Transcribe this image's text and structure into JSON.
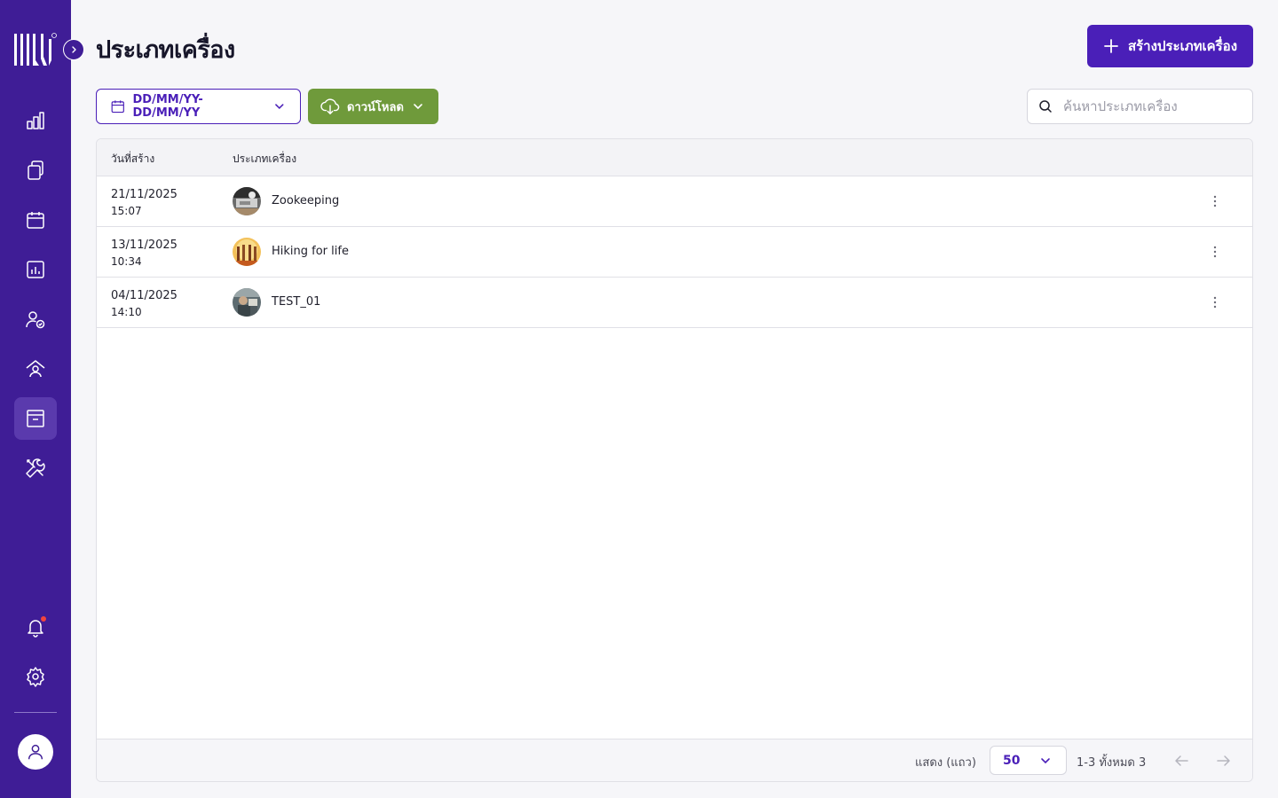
{
  "page": {
    "title": "ประเภทเครื่อง",
    "create_button": "สร้างประเภทเครื่อง"
  },
  "toolbar": {
    "date_range": "DD/MM/YY-DD/MM/YY",
    "download": "ดาวน์โหลด",
    "search_placeholder": "ค้นหาประเภทเครื่อง"
  },
  "table": {
    "columns": [
      "วันที่สร้าง",
      "ประเภทเครื่อง"
    ],
    "rows": [
      {
        "date": "21/11/2025",
        "time": "15:07",
        "name": "Zookeeping"
      },
      {
        "date": "13/11/2025",
        "time": "10:34",
        "name": "Hiking for life"
      },
      {
        "date": "04/11/2025",
        "time": "14:10",
        "name": "TEST_01"
      }
    ]
  },
  "pagination": {
    "rows_label": "แสดง (แถว)",
    "rows_per_page": "50",
    "range": "1-3 ทั้งหมด 3"
  },
  "sidebar": {
    "items": [
      {
        "icon": "bar-chart-icon"
      },
      {
        "icon": "documents-icon"
      },
      {
        "icon": "calendar-icon"
      },
      {
        "icon": "report-icon"
      },
      {
        "icon": "user-check-icon"
      },
      {
        "icon": "home-user-icon"
      },
      {
        "icon": "archive-icon",
        "active": true
      },
      {
        "icon": "tools-icon"
      }
    ],
    "bottom": [
      {
        "icon": "bell-icon"
      },
      {
        "icon": "gear-icon"
      },
      {
        "icon": "user-icon"
      }
    ]
  },
  "colors": {
    "sidebar": "#3f1d96",
    "primary": "#4a1fb8",
    "download": "#6f9a3b",
    "notification_dot": "#f2443d"
  }
}
